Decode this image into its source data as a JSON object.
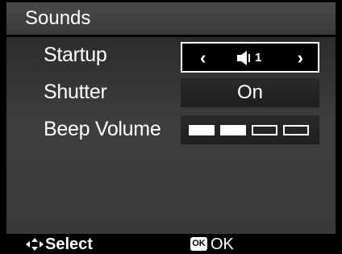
{
  "title": "Sounds",
  "items": [
    {
      "label": "Startup",
      "value": "1",
      "value_icon": "speaker-icon"
    },
    {
      "label": "Shutter",
      "value": "On"
    },
    {
      "label": "Beep Volume",
      "level": 2,
      "max_level": 4
    }
  ],
  "footer": {
    "select_label": "Select",
    "select_icon": "navigate-arrows-icon",
    "ok_badge": "OK",
    "ok_label": "OK"
  }
}
